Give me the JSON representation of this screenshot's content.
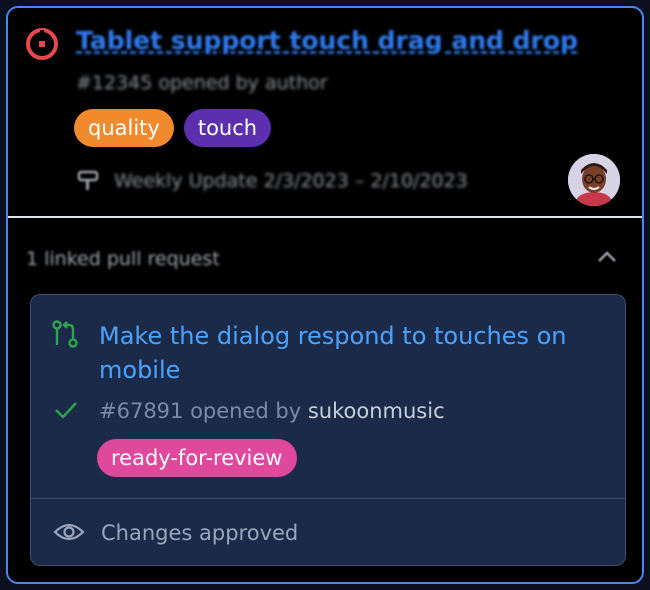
{
  "issue": {
    "title": "Tablet support touch drag and drop",
    "meta": "#12345 opened by author",
    "labels": [
      "quality",
      "touch"
    ],
    "milestone": "Weekly Update  2/3/2023 – 2/10/2023",
    "status_icon": "issue-open-icon",
    "avatar_icon": "avatar"
  },
  "related": {
    "header": "1 linked pull request",
    "collapse_icon": "chevron-up-icon"
  },
  "merge_request": {
    "title": "Make the dialog respond to touches on mobile",
    "number": "#67891",
    "opened_by_text": " opened by ",
    "author": "sukoonmusic",
    "label": "ready-for-review",
    "approval_status": "Changes approved",
    "icons": [
      "merge-request-icon",
      "check-icon",
      "eye-icon"
    ]
  },
  "colors": {
    "accent": "#2f7bf0",
    "link": "#4aa3ff",
    "quality": "#f08a2c",
    "touch": "#5b2fae",
    "review": "#e0489c",
    "card": "#1c2a4a",
    "success": "#2da44e"
  }
}
